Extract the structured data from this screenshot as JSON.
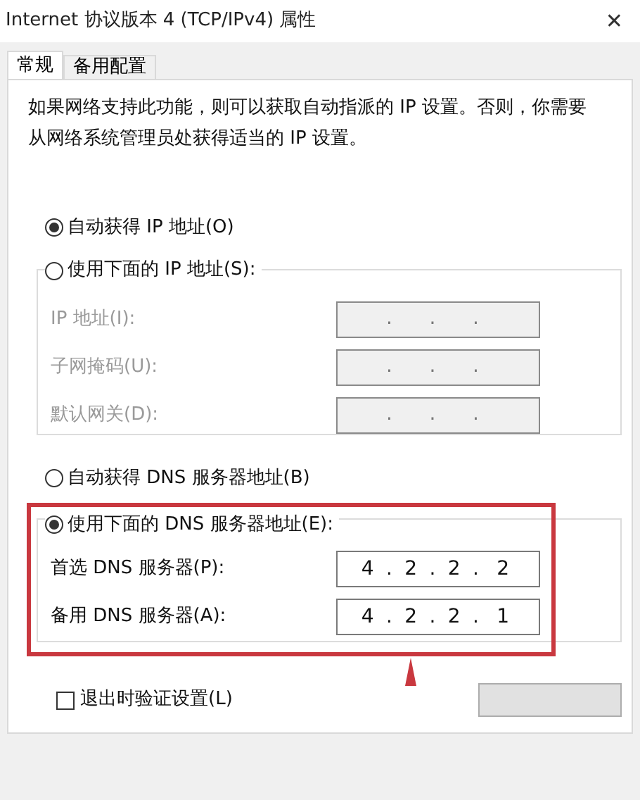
{
  "window": {
    "title": "Internet 协议版本 4 (TCP/IPv4) 属性",
    "close": "✕"
  },
  "tabs": [
    {
      "label": "常规",
      "selected": true
    },
    {
      "label": "备用配置",
      "selected": false
    }
  ],
  "description": "如果网络支持此功能，则可以获取自动指派的 IP 设置。否则，你需要从网络系统管理员处获得适当的 IP 设置。",
  "separator": ".",
  "ip_mode": [
    {
      "label": "自动获得 IP 地址(O)",
      "selected": true
    },
    {
      "label": "使用下面的 IP 地址(S):",
      "selected": false
    }
  ],
  "ip_fields": [
    {
      "label": "IP 地址(I):",
      "disabled": true
    },
    {
      "label": "子网掩码(U):",
      "disabled": true
    },
    {
      "label": "默认网关(D):",
      "disabled": true
    }
  ],
  "dns_mode": [
    {
      "label": "自动获得 DNS 服务器地址(B)",
      "selected": false
    },
    {
      "label": "使用下面的 DNS 服务器地址(E):",
      "selected": true
    }
  ],
  "dns_fields": [
    {
      "label": "首选 DNS 服务器(P):",
      "disabled": false,
      "octets": [
        "4",
        "2",
        "2",
        "2"
      ]
    },
    {
      "label": "备用 DNS 服务器(A):",
      "disabled": false,
      "octets": [
        "4",
        "2",
        "2",
        "1"
      ]
    }
  ],
  "validate_on_exit": {
    "label": "退出时验证设置(L)",
    "checked": false
  }
}
